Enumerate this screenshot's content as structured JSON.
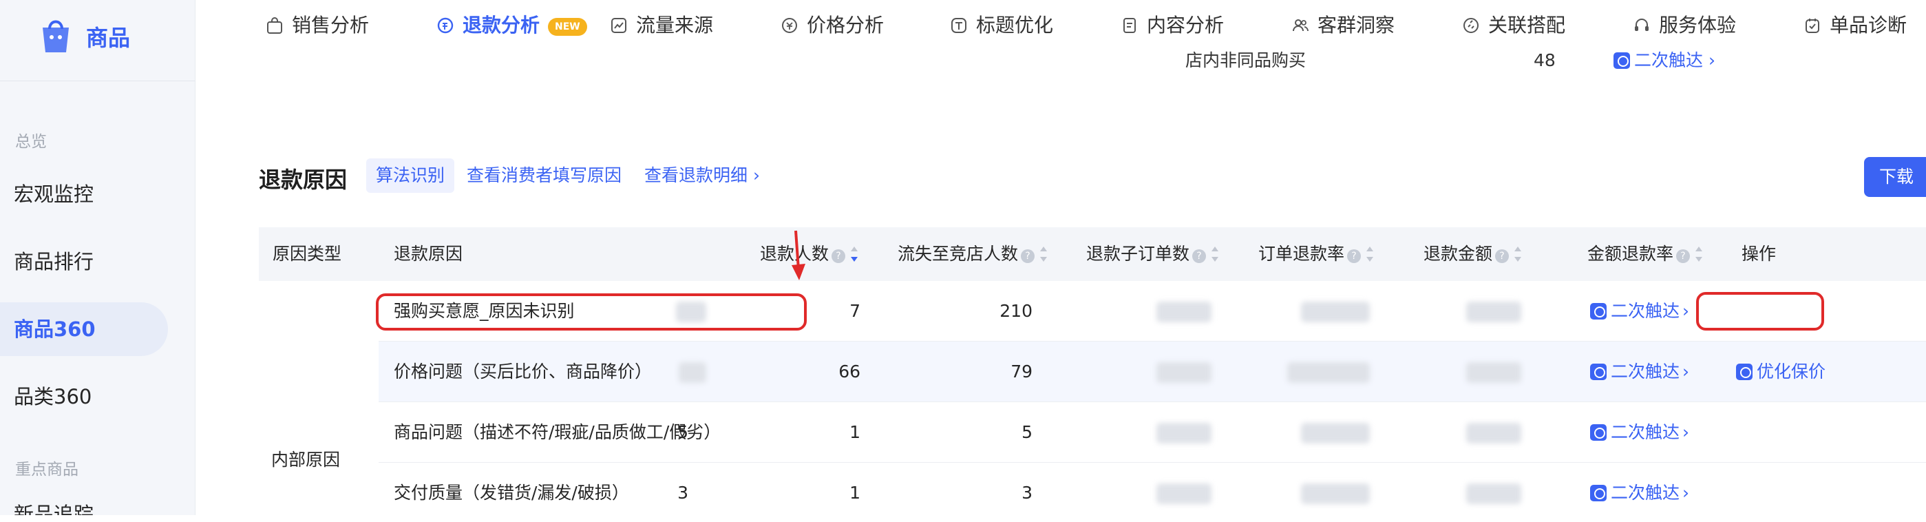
{
  "sidebar": {
    "brand": "商品",
    "sections": [
      {
        "title": "总览",
        "items": [
          {
            "label": "宏观监控",
            "active": false
          },
          {
            "label": "商品排行",
            "active": false
          },
          {
            "label": "商品360",
            "active": true
          },
          {
            "label": "品类360",
            "active": false
          }
        ]
      },
      {
        "title": "重点商品",
        "items": [
          {
            "label": "新品追踪",
            "active": false
          }
        ]
      }
    ]
  },
  "tabs": [
    {
      "label": "销售分析",
      "icon": "bag-icon",
      "active": false
    },
    {
      "label": "退款分析",
      "icon": "refund-icon",
      "active": true,
      "badge": "NEW"
    },
    {
      "label": "流量来源",
      "icon": "trend-icon",
      "active": false
    },
    {
      "label": "价格分析",
      "icon": "price-icon",
      "active": false
    },
    {
      "label": "标题优化",
      "icon": "title-icon",
      "active": false
    },
    {
      "label": "内容分析",
      "icon": "doc-icon",
      "active": false
    },
    {
      "label": "客群洞察",
      "icon": "users-icon",
      "active": false
    },
    {
      "label": "关联搭配",
      "icon": "link-icon",
      "active": false
    },
    {
      "label": "服务体验",
      "icon": "headset-icon",
      "active": false
    },
    {
      "label": "单品诊断",
      "icon": "diagnose-icon",
      "active": false
    }
  ],
  "previous_row": {
    "label": "店内非同品购买",
    "value": "48",
    "action": "二次触达"
  },
  "section": {
    "title": "退款原因",
    "algo_tag": "算法识别",
    "link1": "查看消费者填写原因",
    "link2": "查看退款明细",
    "download": "下载"
  },
  "table": {
    "columns": [
      "原因类型",
      "退款原因",
      "退款人数",
      "流失至竞店人数",
      "退款子订单数",
      "订单退款率",
      "退款金额",
      "金额退款率",
      "操作"
    ],
    "group_label": "内部原因",
    "rows": [
      {
        "reason": "强购买意愿_原因未识别",
        "refund_users": "",
        "lost_users": "7",
        "sub_orders": "210",
        "actions": [
          "二次触达"
        ]
      },
      {
        "reason": "价格问题（买后比价、商品降价）",
        "refund_users": "",
        "lost_users": "66",
        "sub_orders": "79",
        "actions": [
          "二次触达",
          "优化保价"
        ]
      },
      {
        "reason": "商品问题（描述不符/瑕疵/品质做工/假劣）",
        "refund_users": "5",
        "lost_users": "1",
        "sub_orders": "5",
        "actions": [
          "二次触达"
        ]
      },
      {
        "reason": "交付质量（发错货/漏发/破损）",
        "refund_users": "3",
        "lost_users": "1",
        "sub_orders": "3",
        "actions": [
          "二次触达"
        ]
      }
    ]
  },
  "colors": {
    "accent": "#3b63f3",
    "highlight": "#e02a2a",
    "badge": "#f6b21d"
  }
}
